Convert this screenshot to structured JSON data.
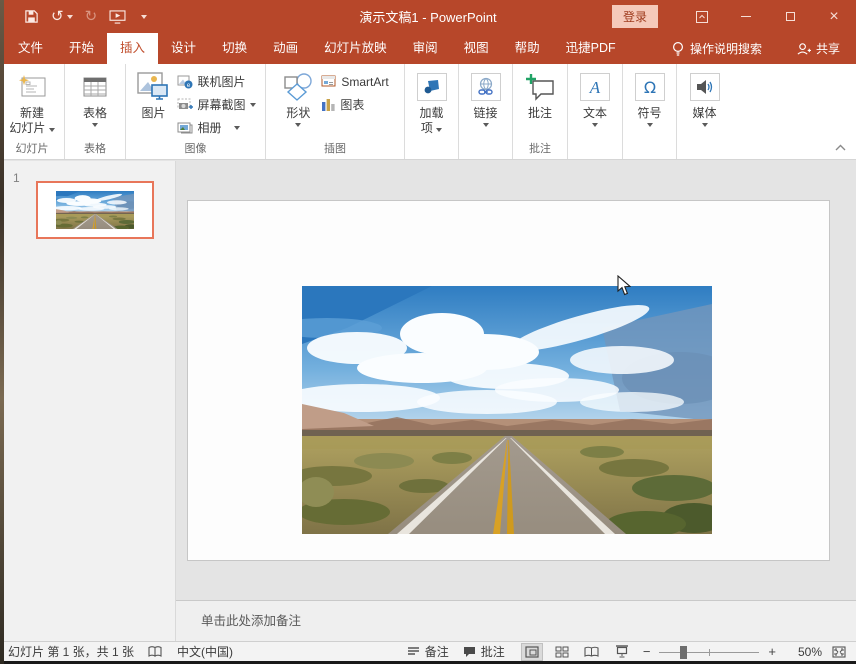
{
  "window": {
    "title": "演示文稿1 - PowerPoint",
    "login_label": "登录"
  },
  "tabs": [
    "文件",
    "开始",
    "插入",
    "设计",
    "切换",
    "动画",
    "幻灯片放映",
    "审阅",
    "视图",
    "帮助",
    "迅捷PDF"
  ],
  "tab_extras": {
    "tell_me": "操作说明搜索",
    "share": "共享"
  },
  "ribbon": {
    "groups": [
      {
        "label": "幻灯片"
      },
      {
        "label": "表格"
      },
      {
        "label": "图像"
      },
      {
        "label": "插图"
      },
      {
        "label": ""
      },
      {
        "label": ""
      },
      {
        "label": "批注"
      },
      {
        "label": ""
      },
      {
        "label": ""
      },
      {
        "label": ""
      }
    ],
    "buttons": {
      "new_slide_l1": "新建",
      "new_slide_l2": "幻灯片",
      "table": "表格",
      "picture": "图片",
      "online_pictures": "联机图片",
      "screenshot": "屏幕截图",
      "photo_album": "相册",
      "shapes": "形状",
      "smartart": "SmartArt",
      "chart": "图表",
      "addins_l1": "加载",
      "addins_l2": "项",
      "links": "链接",
      "comment": "批注",
      "text": "文本",
      "symbols": "符号",
      "media": "媒体"
    }
  },
  "slide_panel": {
    "slide_number": "1"
  },
  "notes": {
    "placeholder": "单击此处添加备注"
  },
  "statusbar": {
    "slide_info": "幻灯片 第 1 张，共 1 张",
    "language": "中文(中国)",
    "notes_label": "备注",
    "comments_label": "批注",
    "zoom_level": "50%"
  },
  "icons": {
    "undo": "↺",
    "redo": "↻",
    "close": "×"
  },
  "colors": {
    "titlebar": "#b7472a",
    "active_tab_text": "#c14f2e",
    "login_bg": "#f5c9ba",
    "thumbnail_border": "#e8765a"
  }
}
